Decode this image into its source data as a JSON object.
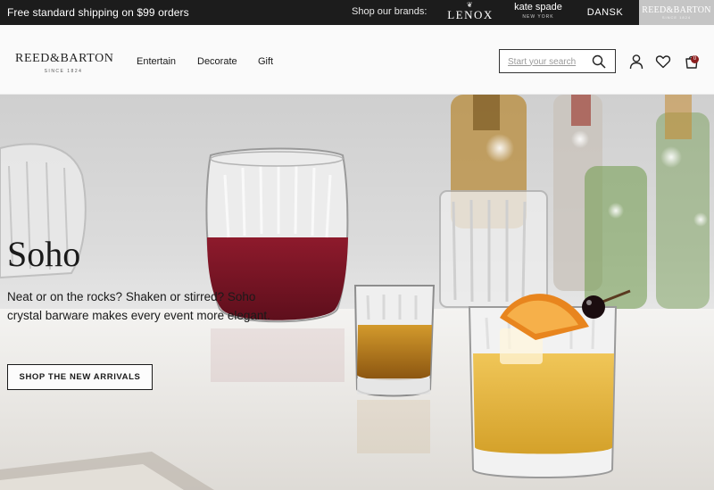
{
  "promo": {
    "text": "Free standard shipping on $99 orders"
  },
  "brands": {
    "label": "Shop our brands:",
    "lenox": "LENOX",
    "kate_spade": "kate spade",
    "kate_spade_sub": "NEW YORK",
    "dansk": "DANSK",
    "reed_barton": "REED&BARTON",
    "reed_barton_sub": "SINCE 1824"
  },
  "header": {
    "logo": "REED&BARTON",
    "logo_sub": "SINCE 1824",
    "nav": [
      "Entertain",
      "Decorate",
      "Gift"
    ],
    "search_placeholder": "Start your search",
    "cart_count": "0"
  },
  "hero": {
    "title": "Soho",
    "body": "Neat or on the rocks? Shaken or stirred? Soho crystal barware makes every event more elegant.",
    "cta": "SHOP THE NEW ARRIVALS"
  },
  "colors": {
    "promo_bg": "#1c1c1c",
    "header_bg": "#fafafa",
    "cart_badge": "#8b1d1d",
    "wine": "#7a1424",
    "whiskey": "#b5781b",
    "cocktail": "#e2b43a"
  },
  "icons": [
    "search-icon",
    "account-icon",
    "heart-icon",
    "shopping-bag-icon"
  ]
}
